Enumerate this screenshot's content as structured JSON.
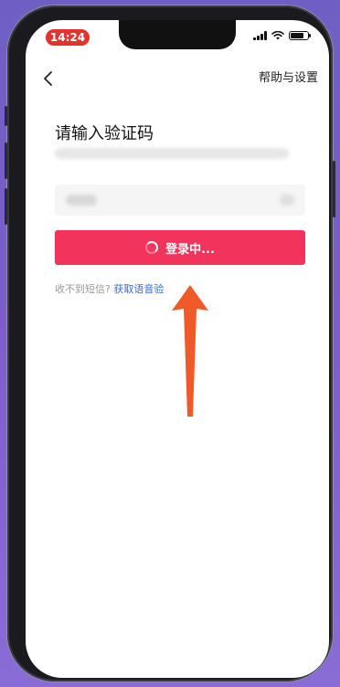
{
  "status_bar": {
    "time": "14:24"
  },
  "header": {
    "help_label": "帮助与设置"
  },
  "main": {
    "title": "请输入验证码",
    "login_button_label": "登录中...",
    "no_sms_text": "收不到短信?",
    "voice_link_text": "获取语音验"
  },
  "colors": {
    "accent": "#f2335c",
    "link": "#3a6cc8",
    "arrow": "#f05a28",
    "time_pill": "#e5322f"
  },
  "icons": {
    "back": "chevron-left-icon",
    "spinner": "loading-spinner-icon",
    "signal": "signal-icon",
    "wifi": "wifi-icon",
    "battery": "battery-icon",
    "annotation": "arrow-up-annotation"
  }
}
